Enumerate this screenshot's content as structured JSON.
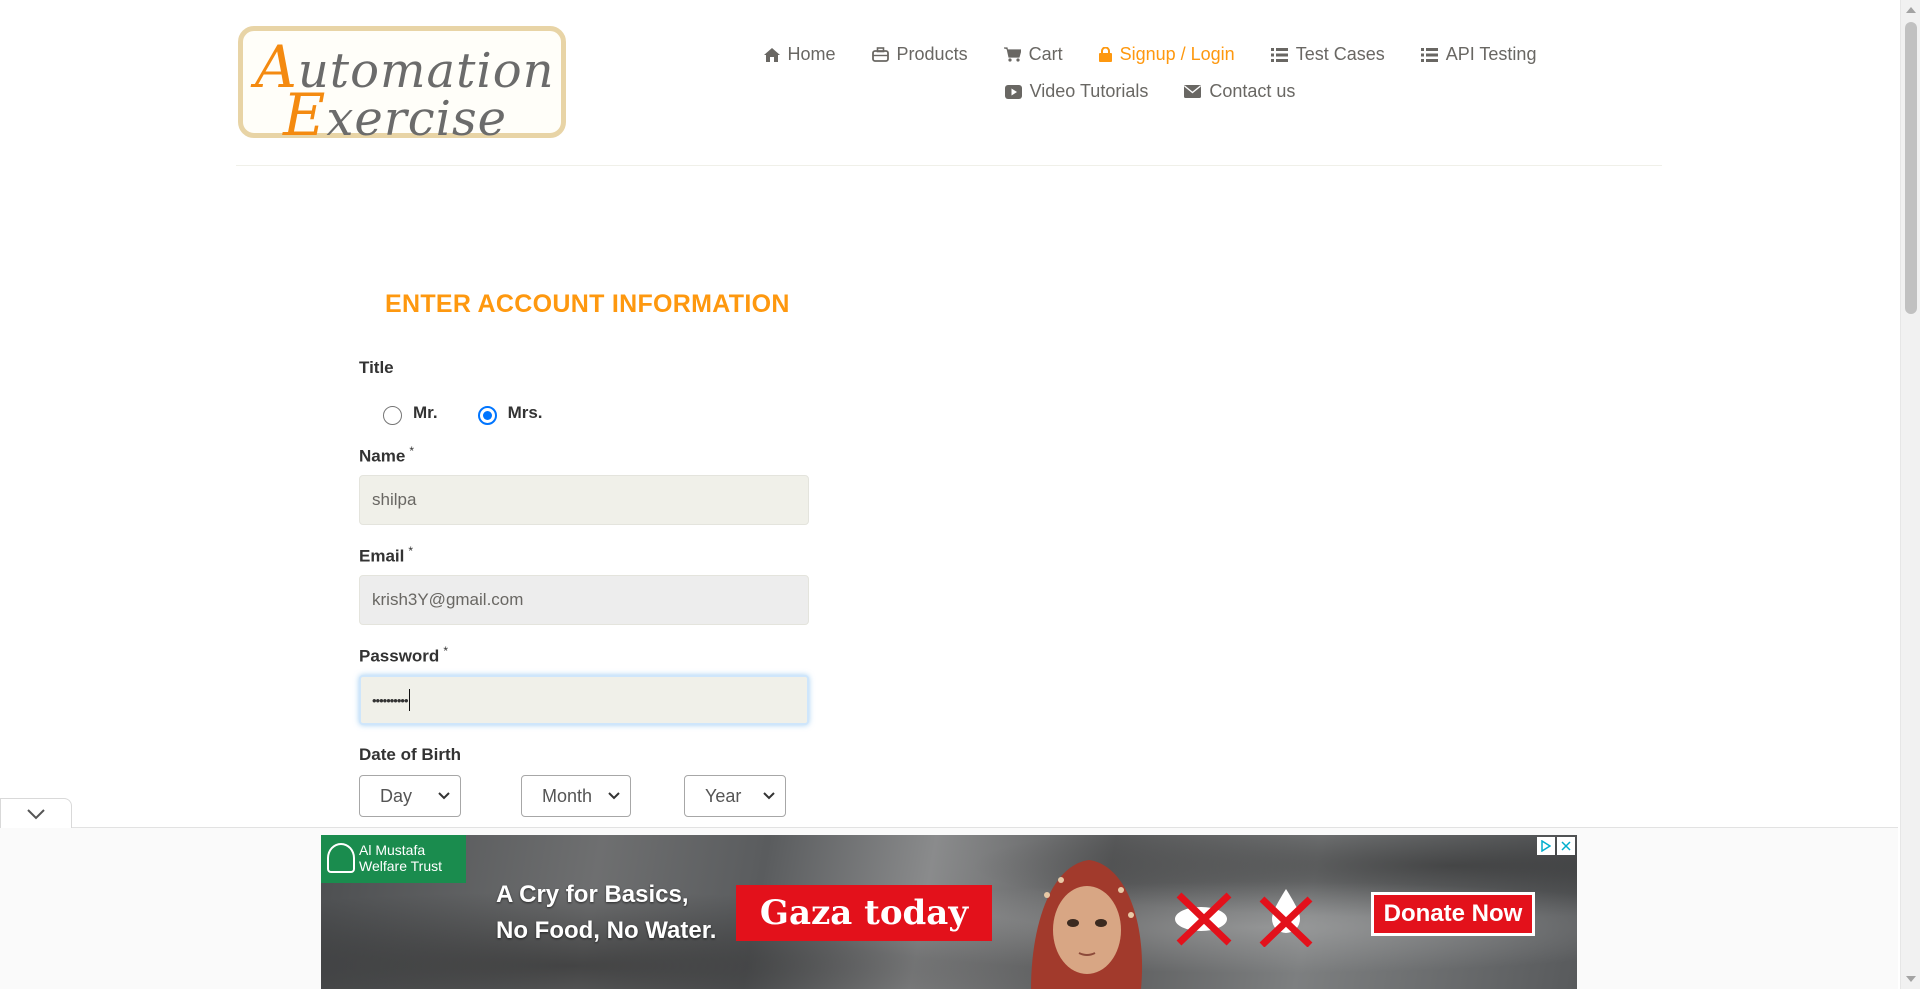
{
  "logo": {
    "line1_cap": "A",
    "line1_rest": "utomation",
    "line2_cap": "E",
    "line2_rest": "xercise"
  },
  "nav": {
    "row1": [
      {
        "label": "Home",
        "icon": "home-icon",
        "active": false
      },
      {
        "label": "Products",
        "icon": "briefcase-icon",
        "active": false
      },
      {
        "label": "Cart",
        "icon": "cart-icon",
        "active": false
      },
      {
        "label": "Signup / Login",
        "icon": "lock-icon",
        "active": true
      },
      {
        "label": "Test Cases",
        "icon": "list-icon",
        "active": false
      },
      {
        "label": "API Testing",
        "icon": "list-icon",
        "active": false
      }
    ],
    "row2": [
      {
        "label": "Video Tutorials",
        "icon": "youtube-icon",
        "active": false
      },
      {
        "label": "Contact us",
        "icon": "envelope-icon",
        "active": false
      }
    ]
  },
  "form": {
    "heading": "ENTER ACCOUNT INFORMATION",
    "title_label": "Title",
    "title_options": [
      {
        "label": "Mr.",
        "checked": false
      },
      {
        "label": "Mrs.",
        "checked": true
      }
    ],
    "name_label": "Name",
    "name_value": "shilpa",
    "email_label": "Email",
    "email_value": "krish3Y@gmail.com",
    "password_label": "Password",
    "password_value": "••••••••••",
    "required_mark": "*",
    "dob_label": "Date of Birth",
    "dob_day": "Day",
    "dob_month": "Month",
    "dob_year": "Year"
  },
  "ad": {
    "org_name_line1": "Al Mustafa",
    "org_name_line2": "Welfare Trust",
    "tagline_line1": "A Cry for Basics,",
    "tagline_line2": "No Food, No Water.",
    "headline": "Gaza today",
    "cta": "Donate Now"
  },
  "colors": {
    "accent": "#fe980f",
    "text": "#696763",
    "field_bg": "#f0f0e9",
    "ad_red": "#e3111b",
    "ad_green": "#1a8c4e"
  }
}
